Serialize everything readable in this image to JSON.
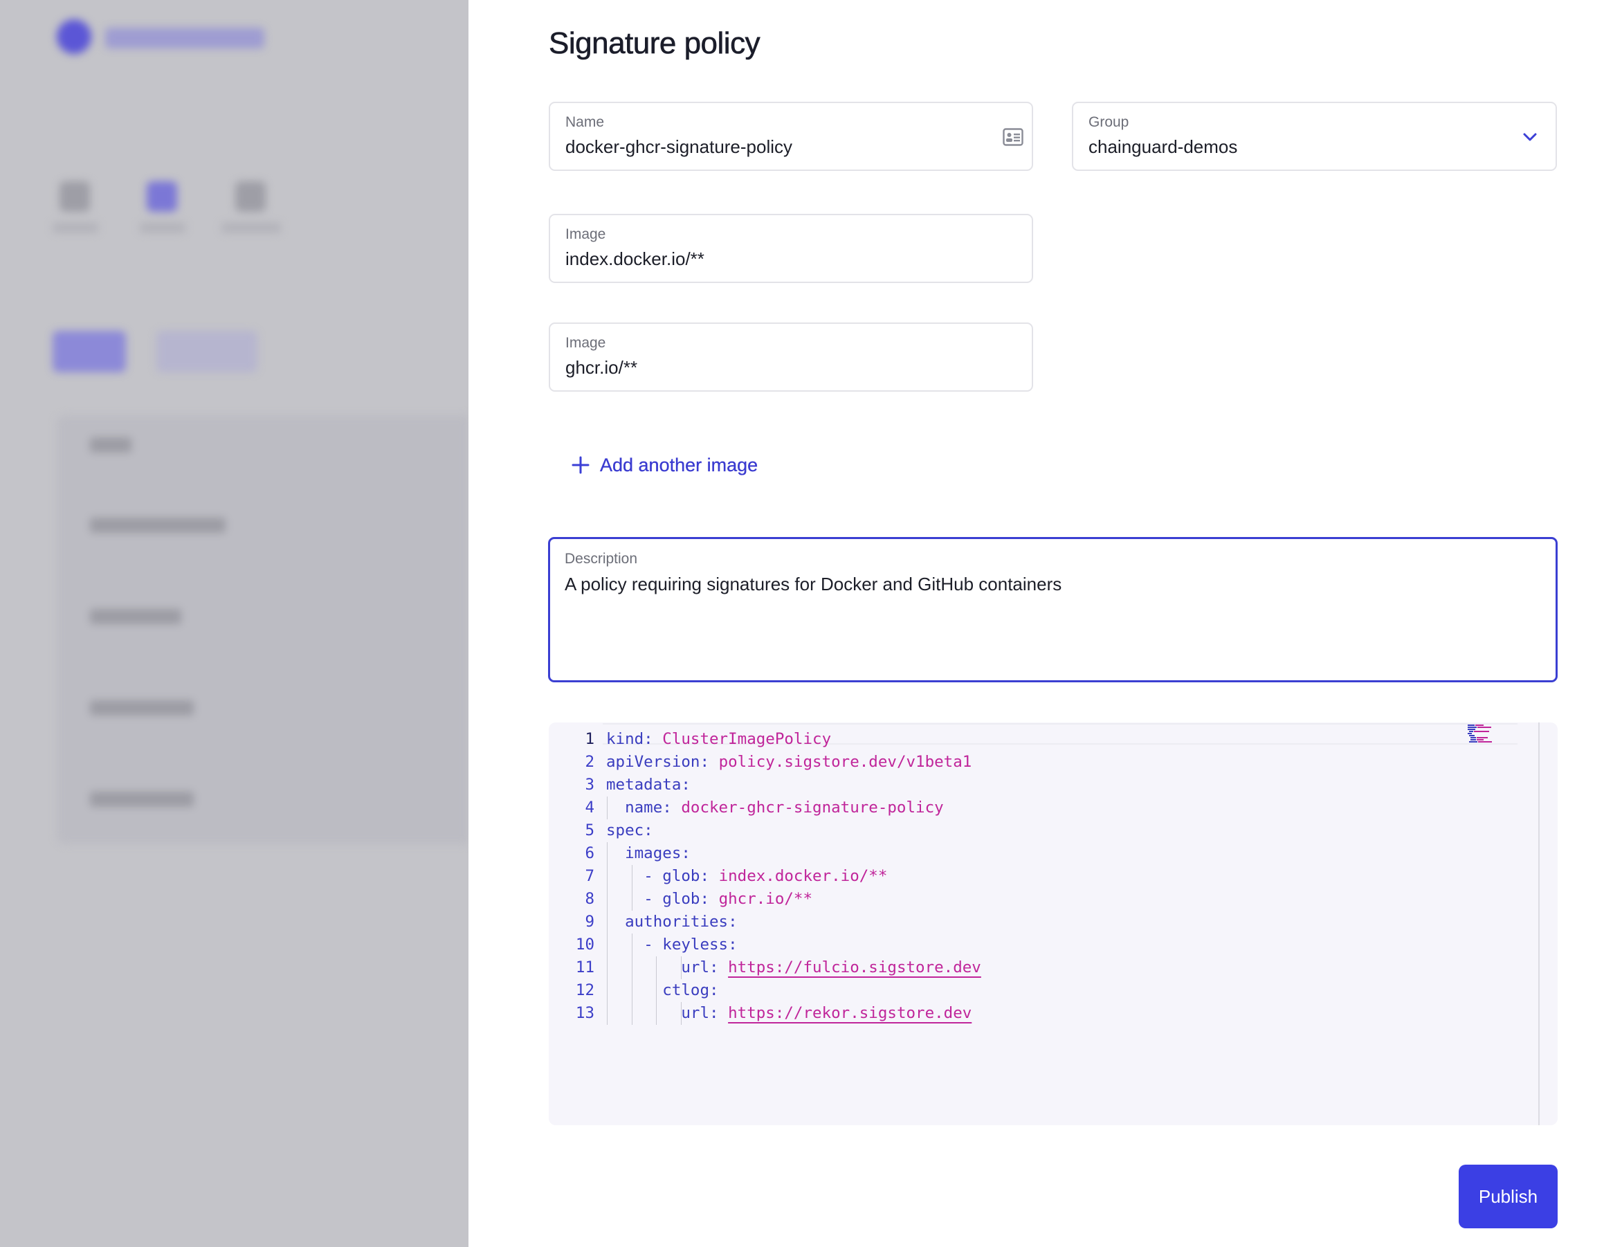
{
  "panel": {
    "title": "Signature policy",
    "name": {
      "label": "Name",
      "value": "docker-ghcr-signature-policy",
      "icon": "contact-card-icon"
    },
    "group": {
      "label": "Group",
      "value": "chainguard-demos",
      "icon": "chevron-down-icon"
    },
    "images": [
      {
        "label": "Image",
        "value": "index.docker.io/**"
      },
      {
        "label": "Image",
        "value": "ghcr.io/**"
      }
    ],
    "add_image": {
      "label": "Add another image",
      "icon": "plus-icon"
    },
    "description": {
      "label": "Description",
      "value": "A policy requiring signatures for Docker and GitHub containers"
    },
    "publish_label": "Publish"
  },
  "editor": {
    "lines": [
      {
        "num": "1",
        "indent": "",
        "key": "kind:",
        "value": "ClusterImagePolicy",
        "link": false
      },
      {
        "num": "2",
        "indent": "",
        "key": "apiVersion:",
        "value": "policy.sigstore.dev/v1beta1",
        "link": false
      },
      {
        "num": "3",
        "indent": "",
        "key": "metadata:",
        "value": "",
        "link": false
      },
      {
        "num": "4",
        "indent": "  ",
        "key": "name:",
        "value": "docker-ghcr-signature-policy",
        "link": false
      },
      {
        "num": "5",
        "indent": "",
        "key": "spec:",
        "value": "",
        "link": false
      },
      {
        "num": "6",
        "indent": "  ",
        "key": "images:",
        "value": "",
        "link": false
      },
      {
        "num": "7",
        "indent": "    ",
        "key": "- glob:",
        "value": "index.docker.io/**",
        "link": false
      },
      {
        "num": "8",
        "indent": "    ",
        "key": "- glob:",
        "value": "ghcr.io/**",
        "link": false
      },
      {
        "num": "9",
        "indent": "  ",
        "key": "authorities:",
        "value": "",
        "link": false
      },
      {
        "num": "10",
        "indent": "    ",
        "key": "- keyless:",
        "value": "",
        "link": false
      },
      {
        "num": "11",
        "indent": "        ",
        "key": "url:",
        "value": "https://fulcio.sigstore.dev",
        "link": true
      },
      {
        "num": "12",
        "indent": "      ",
        "key": "ctlog:",
        "value": "",
        "link": false
      },
      {
        "num": "13",
        "indent": "        ",
        "key": "url:",
        "value": "https://rekor.sigstore.dev",
        "link": true
      }
    ]
  },
  "colors": {
    "accent": "#3b3fe4",
    "yaml_key": "#3a3dbf",
    "yaml_value": "#c0259a",
    "editor_bg": "#f6f5fb",
    "backdrop": "#c4c4c9"
  }
}
